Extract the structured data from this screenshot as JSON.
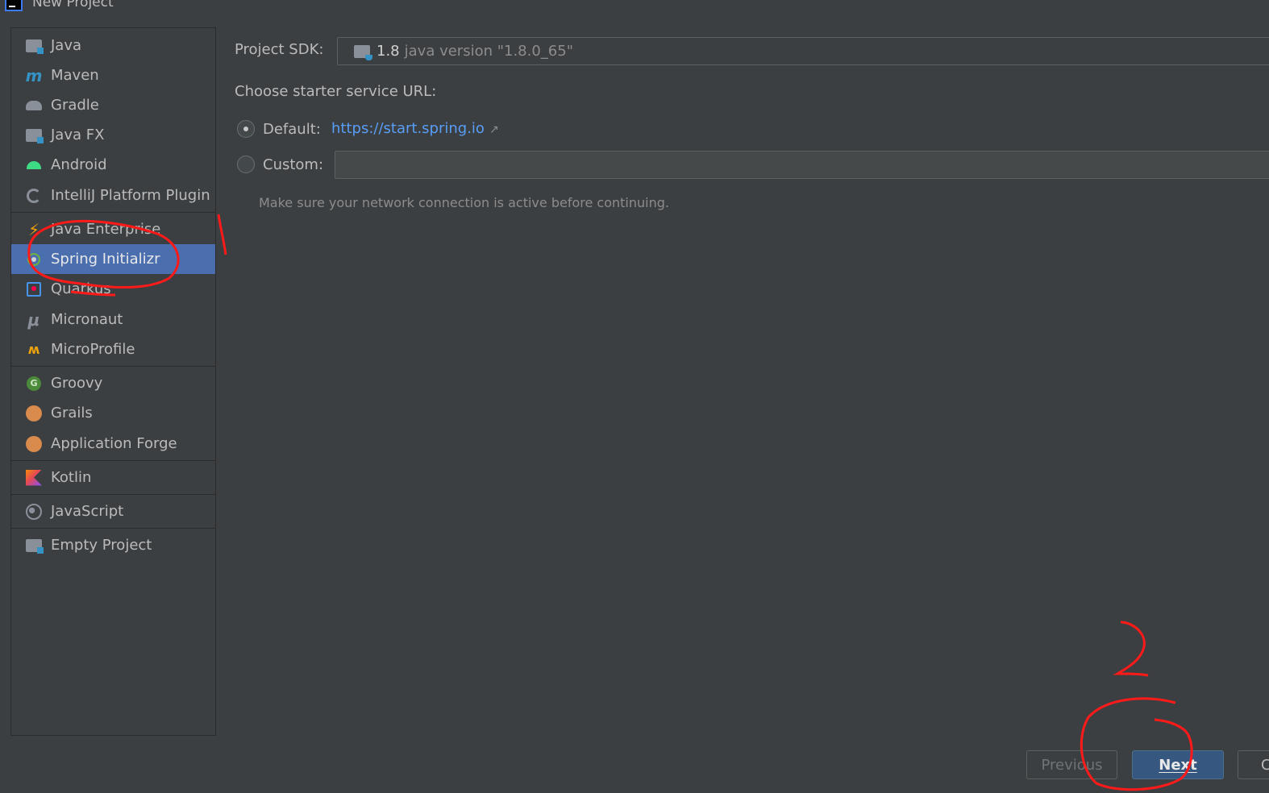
{
  "window": {
    "title": "New Project"
  },
  "sidebar": {
    "items": [
      {
        "label": "Java",
        "icon": "folder-icon"
      },
      {
        "label": "Maven",
        "icon": "maven-icon"
      },
      {
        "label": "Gradle",
        "icon": "gradle-icon"
      },
      {
        "label": "Java FX",
        "icon": "folder-icon"
      },
      {
        "label": "Android",
        "icon": "android-icon"
      },
      {
        "label": "IntelliJ Platform Plugin",
        "icon": "plugin-icon"
      },
      {
        "label": "Java Enterprise",
        "icon": "java-enterprise-icon"
      },
      {
        "label": "Spring Initializr",
        "icon": "spring-icon",
        "selected": true
      },
      {
        "label": "Quarkus",
        "icon": "quarkus-icon"
      },
      {
        "label": "Micronaut",
        "icon": "micronaut-icon"
      },
      {
        "label": "MicroProfile",
        "icon": "microprofile-icon"
      },
      {
        "label": "Groovy",
        "icon": "groovy-icon"
      },
      {
        "label": "Grails",
        "icon": "grails-icon"
      },
      {
        "label": "Application Forge",
        "icon": "grails-icon"
      },
      {
        "label": "Kotlin",
        "icon": "kotlin-icon"
      },
      {
        "label": "JavaScript",
        "icon": "javascript-icon"
      },
      {
        "label": "Empty Project",
        "icon": "folder-icon"
      }
    ]
  },
  "main": {
    "sdk_label": "Project SDK:",
    "sdk_value": "1.8",
    "sdk_detail": "java version \"1.8.0_65\"",
    "service_url_label": "Choose starter service URL:",
    "default_label": "Default:",
    "default_url": "https://start.spring.io",
    "default_checked": true,
    "custom_label": "Custom:",
    "custom_value": "",
    "hint": "Make sure your network connection is active before continuing."
  },
  "footer": {
    "previous_label": "Previous",
    "next_label": "Next",
    "cancel_label": "C"
  },
  "annotations": {
    "label_1": "1",
    "label_2": "2",
    "color": "#ff1a1a"
  },
  "colors": {
    "background": "#3c3f41",
    "selection": "#4b6eaf",
    "link": "#589df6",
    "primary_button": "#365880"
  }
}
